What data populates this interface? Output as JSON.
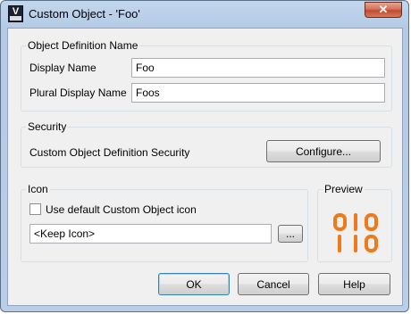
{
  "window": {
    "title": "Custom Object - 'Foo'",
    "app_icon_letter": "V",
    "close_glyph": "✕"
  },
  "object_definition": {
    "group_label": "Object Definition Name",
    "display_name_label": "Display Name",
    "display_name_value": "Foo",
    "plural_label": "Plural Display Name",
    "plural_value": "Foos"
  },
  "security": {
    "group_label": "Security",
    "description": "Custom Object Definition Security",
    "configure_button": "Configure..."
  },
  "icon": {
    "group_label": "Icon",
    "use_default_label": "Use default Custom Object icon",
    "use_default_checked": false,
    "icon_path_value": "<Keep Icon>",
    "browse_button": "..."
  },
  "preview": {
    "group_label": "Preview",
    "icon_name": "binary-010-110-icon",
    "icon_color": "#f07a1a"
  },
  "buttons": {
    "ok": "OK",
    "cancel": "Cancel",
    "help": "Help"
  }
}
